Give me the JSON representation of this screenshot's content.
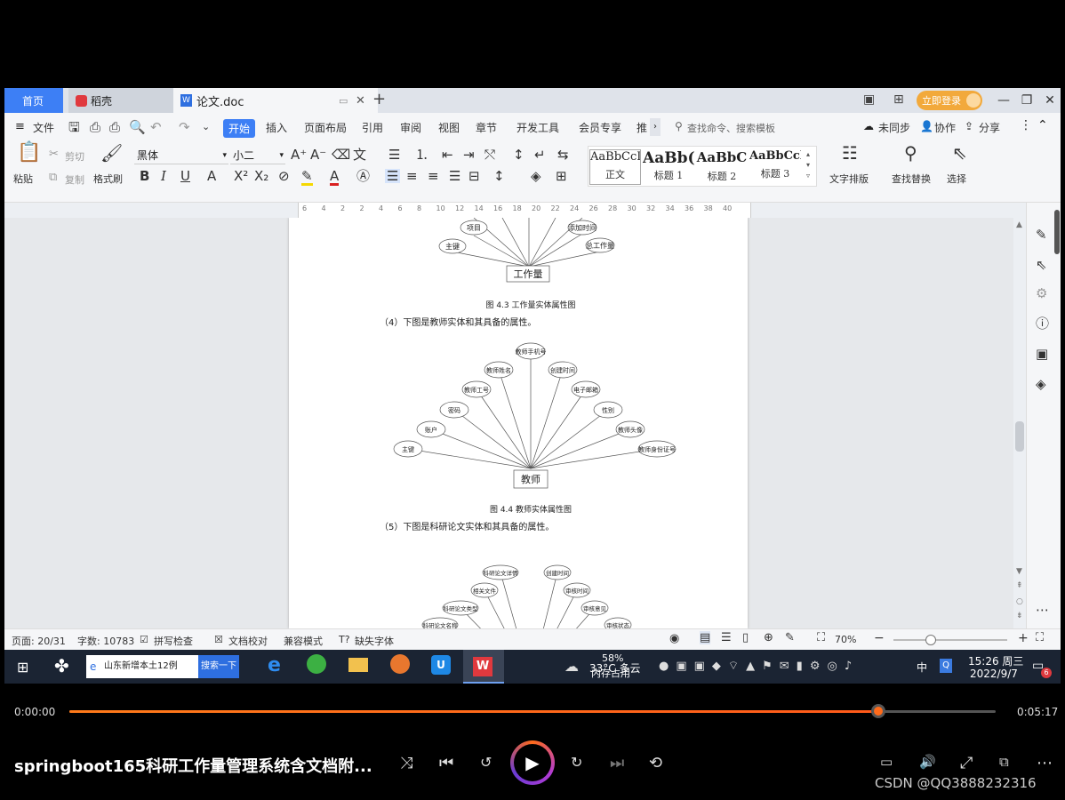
{
  "tabs": {
    "home": "首页",
    "wps": "稻壳",
    "doc": "论文.doc",
    "plus": "+",
    "login": "立即登录"
  },
  "menu": {
    "file": "文件",
    "items": [
      "开始",
      "插入",
      "页面布局",
      "引用",
      "审阅",
      "视图",
      "章节",
      "开发工具",
      "会员专享",
      "推"
    ],
    "search_placeholder": "查找命令、搜索模板",
    "sync": "未同步",
    "collab": "协作",
    "share": "分享"
  },
  "ribbon": {
    "paste": "粘贴",
    "cut": "剪切",
    "copy": "复制",
    "format_painter": "格式刷",
    "font": "黑体",
    "size": "小二",
    "styles": [
      {
        "preview": "AaBbCcI",
        "name": "正文"
      },
      {
        "preview": "AaBb(",
        "name": "标题 1"
      },
      {
        "preview": "AaBbC",
        "name": "标题 2"
      },
      {
        "preview": "AaBbCcl",
        "name": "标题 3"
      }
    ],
    "text_layout": "文字排版",
    "find_replace": "查找替换",
    "select": "选择"
  },
  "ruler_ticks": [
    "6",
    "4",
    "2",
    "2",
    "4",
    "6",
    "8",
    "10",
    "12",
    "14",
    "16",
    "18",
    "20",
    "22",
    "24",
    "26",
    "28",
    "30",
    "32",
    "34",
    "36",
    "38",
    "40"
  ],
  "doc": {
    "diag1": {
      "entity": "工作量",
      "attrs": [
        "主键",
        "项目",
        "添加时间",
        "总工作量"
      ],
      "caption": "图 4.3 工作量实体属性图"
    },
    "para4": "（4）下图是教师实体和其具备的属性。",
    "diag2": {
      "entity": "教师",
      "attrs": [
        "主键",
        "账户",
        "密码",
        "教师工号",
        "教师姓名",
        "教师手机号",
        "创建时间",
        "电子邮箱",
        "性别",
        "教师头像",
        "教师身份证号"
      ],
      "caption": "图 4.4 教师实体属性图"
    },
    "para5": "（5）下图是科研论文实体和其具备的属性。",
    "diag3": {
      "attrs": [
        "科研论文详情",
        "创建时间",
        "相关文件",
        "审核时间",
        "科研论文类型",
        "审核意见",
        "科研论文名称",
        "审核状态"
      ]
    }
  },
  "status": {
    "page": "页面: 20/31",
    "words": "字数: 10783",
    "spell": "拼写检查",
    "doc_check": "文档校对",
    "compat": "兼容模式",
    "missing_font": "缺失字体",
    "zoom": "70%"
  },
  "taskbar": {
    "search_text": "山东新增本土12例",
    "search_btn": "搜索一下",
    "weather": "33°C 多云",
    "mem_pct": "58%",
    "mem_label": "内存占用",
    "ime": "中",
    "time": "15:26 周三",
    "date": "2022/9/7",
    "notif": "6"
  },
  "player": {
    "current": "0:00:00",
    "total": "0:05:17",
    "progress": 0.873,
    "title": "springboot165科研工作量管理系统含文档附...",
    "watermark": "CSDN @QQ3888232316"
  }
}
